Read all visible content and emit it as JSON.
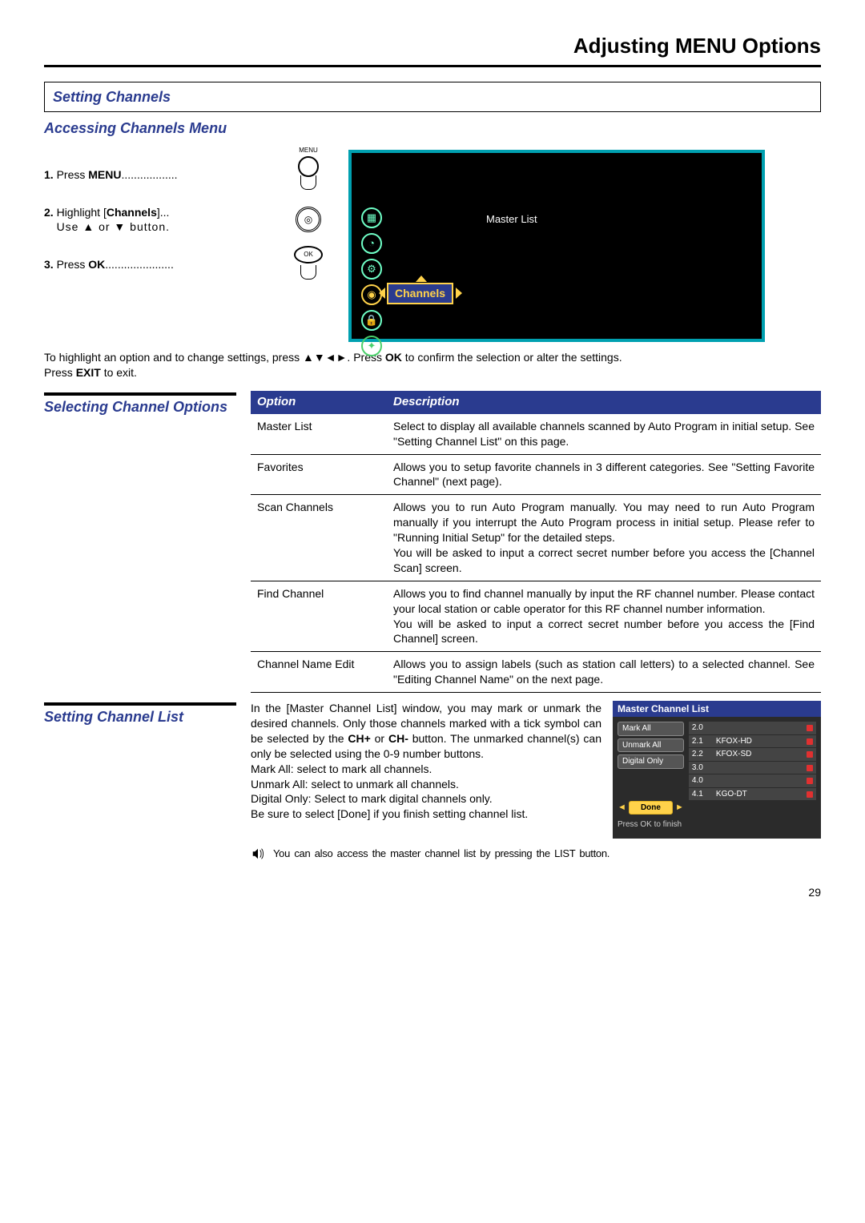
{
  "page_title": "Adjusting MENU Options",
  "page_number": "29",
  "section_heading": "Setting Channels",
  "access_heading": "Accessing Channels Menu",
  "steps": {
    "s1_prefix": "1. ",
    "s1_a": "Press ",
    "s1_b": "MENU",
    "s1_dots": "..................",
    "s1_icon_label": "MENU",
    "s2_prefix": "2. ",
    "s2_a": "Highlight [",
    "s2_b": "Channels",
    "s2_c": "]...",
    "s2_use": "Use ▲ or ▼ button.",
    "s3_prefix": "3. ",
    "s3_a": "Press ",
    "s3_b": "OK",
    "s3_dots": "......................",
    "s3_icon_label": "OK"
  },
  "osd": {
    "master_list": "Master List",
    "channels": "Channels"
  },
  "instr_l1_a": "To highlight an option and to change settings, press ▲▼◄►. Press ",
  "instr_l1_b": "OK",
  "instr_l1_c": " to confirm the selection or alter the settings.",
  "instr_l2_a": "Press ",
  "instr_l2_b": "EXIT",
  "instr_l2_c": " to exit.",
  "selecting_heading": "Selecting Channel Options",
  "table": {
    "h_option": "Option",
    "h_desc": "Description",
    "rows": [
      {
        "opt": "Master List",
        "desc": "Select to display all available channels scanned by Auto Program in initial setup. See \"Setting Channel List\" on this page."
      },
      {
        "opt": "Favorites",
        "desc": "Allows you to setup favorite channels in 3 different categories. See \"Setting Favorite Channel\" (next page)."
      },
      {
        "opt": "Scan Channels",
        "desc": "Allows you to run Auto Program manually. You may need to run Auto Program manually if you interrupt the Auto Program process in initial setup. Please refer to \"Running Initial Setup\" for the detailed steps.\nYou will be asked to input a correct secret number before you access the [Channel Scan] screen."
      },
      {
        "opt": "Find Channel",
        "desc": "Allows you to find channel manually by input the RF channel number. Please contact your local station or cable operator for this RF channel number information.\nYou will be asked to input a correct secret number before you access the [Find Channel] screen."
      },
      {
        "opt": "Channel Name Edit",
        "desc": "Allows you to assign labels (such as station call letters) to a selected channel. See \"Editing Channel Name\" on the next page."
      }
    ]
  },
  "setting_list_heading": "Setting Channel List",
  "setting_list_p1a": "In the [Master Channel List] window, you may mark or unmark the desired channels. Only those channels marked with a tick symbol can be selected by the ",
  "setting_list_p1b": "CH+",
  "setting_list_p1c": " or ",
  "setting_list_p1d": "CH-",
  "setting_list_p1e": " button. The unmarked channel(s) can only be selected using the 0-9 number buttons.",
  "setting_list_p2": "Mark All: select to mark all channels.",
  "setting_list_p3": "Unmark All: select to unmark all channels.",
  "setting_list_p4": "Digital Only: Select to mark digital channels only.",
  "setting_list_p5": "Be sure to select [Done] if you finish setting channel list.",
  "note": "You can also access the master channel list by pressing the LIST button.",
  "mcl": {
    "title": "Master Channel List",
    "btn_mark_all": "Mark All",
    "btn_unmark_all": "Unmark All",
    "btn_digital_only": "Digital Only",
    "btn_done": "Done",
    "footer": "Press OK to finish",
    "rows": [
      {
        "ch": "2.0",
        "name": ""
      },
      {
        "ch": "2.1",
        "name": "KFOX-HD"
      },
      {
        "ch": "2.2",
        "name": "KFOX-SD"
      },
      {
        "ch": "3.0",
        "name": ""
      },
      {
        "ch": "4.0",
        "name": ""
      },
      {
        "ch": "4.1",
        "name": "KGO-DT"
      }
    ]
  }
}
